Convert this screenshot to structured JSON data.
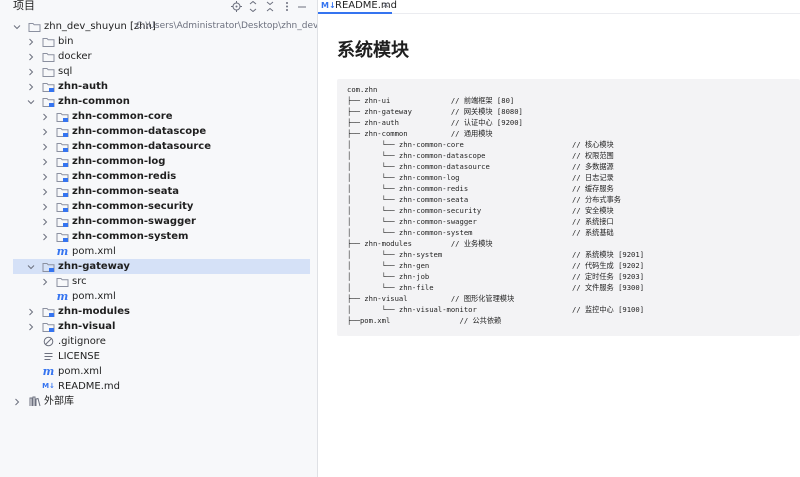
{
  "project_panel": {
    "title": "项目",
    "tree": [
      {
        "label": "zhn_dev_shuyun [zhn]",
        "path": "C:\\Users\\Administrator\\Desktop\\zhn_dev_shuyu",
        "type": "root-folder",
        "bold": false,
        "depth": 0,
        "expanded": true
      },
      {
        "label": "bin",
        "type": "folder",
        "depth": 1,
        "expanded": false,
        "bold": false
      },
      {
        "label": "docker",
        "type": "folder",
        "depth": 1,
        "expanded": false,
        "bold": false
      },
      {
        "label": "sql",
        "type": "folder",
        "depth": 1,
        "expanded": false,
        "bold": false
      },
      {
        "label": "zhn-auth",
        "type": "module",
        "depth": 1,
        "expanded": false,
        "bold": true
      },
      {
        "label": "zhn-common",
        "type": "module",
        "depth": 1,
        "expanded": true,
        "bold": true
      },
      {
        "label": "zhn-common-core",
        "type": "module",
        "depth": 2,
        "expanded": false,
        "bold": true
      },
      {
        "label": "zhn-common-datascope",
        "type": "module",
        "depth": 2,
        "expanded": false,
        "bold": true
      },
      {
        "label": "zhn-common-datasource",
        "type": "module",
        "depth": 2,
        "expanded": false,
        "bold": true
      },
      {
        "label": "zhn-common-log",
        "type": "module",
        "depth": 2,
        "expanded": false,
        "bold": true
      },
      {
        "label": "zhn-common-redis",
        "type": "module",
        "depth": 2,
        "expanded": false,
        "bold": true
      },
      {
        "label": "zhn-common-seata",
        "type": "module",
        "depth": 2,
        "expanded": false,
        "bold": true
      },
      {
        "label": "zhn-common-security",
        "type": "module",
        "depth": 2,
        "expanded": false,
        "bold": true
      },
      {
        "label": "zhn-common-swagger",
        "type": "module",
        "depth": 2,
        "expanded": false,
        "bold": true
      },
      {
        "label": "zhn-common-system",
        "type": "module",
        "depth": 2,
        "expanded": false,
        "bold": true
      },
      {
        "label": "pom.xml",
        "type": "maven",
        "depth": 2,
        "bold": false
      },
      {
        "label": "zhn-gateway",
        "type": "module",
        "depth": 1,
        "expanded": true,
        "bold": true,
        "selected": true
      },
      {
        "label": "src",
        "type": "folder",
        "depth": 2,
        "expanded": false,
        "bold": false
      },
      {
        "label": "pom.xml",
        "type": "maven",
        "depth": 2,
        "bold": false
      },
      {
        "label": "zhn-modules",
        "type": "module",
        "depth": 1,
        "expanded": false,
        "bold": true
      },
      {
        "label": "zhn-visual",
        "type": "module",
        "depth": 1,
        "expanded": false,
        "bold": true
      },
      {
        "label": ".gitignore",
        "type": "ignore",
        "depth": 1,
        "bold": false
      },
      {
        "label": "LICENSE",
        "type": "text",
        "depth": 1,
        "bold": false
      },
      {
        "label": "pom.xml",
        "type": "maven",
        "depth": 1,
        "bold": false
      },
      {
        "label": "README.md",
        "type": "markdown",
        "depth": 1,
        "bold": false
      },
      {
        "label": "外部库",
        "type": "library",
        "depth": 0,
        "expanded": false,
        "bold": false
      }
    ]
  },
  "editor": {
    "tab": {
      "icon_text": "M↓",
      "label": "README.md"
    },
    "doc_title": "系统模块",
    "code_lines": [
      "com.zhn",
      "├── zhn-ui              // 前端框架 [80]",
      "├── zhn-gateway         // 网关模块 [8080]",
      "├── zhn-auth            // 认证中心 [9200]",
      "├── zhn-common          // 通用模块",
      "│       └── zhn-common-core                         // 核心模块",
      "│       └── zhn-common-datascope                    // 权限范围",
      "│       └── zhn-common-datasource                   // 多数据源",
      "│       └── zhn-common-log                          // 日志记录",
      "│       └── zhn-common-redis                        // 缓存服务",
      "│       └── zhn-common-seata                        // 分布式事务",
      "│       └── zhn-common-security                     // 安全模块",
      "│       └── zhn-common-swagger                      // 系统接口",
      "│       └── zhn-common-system                       // 系统基础",
      "├── zhn-modules         // 业务模块",
      "│       └── zhn-system                              // 系统模块 [9201]",
      "│       └── zhn-gen                                 // 代码生成 [9202]",
      "│       └── zhn-job                                 // 定时任务 [9203]",
      "│       └── zhn-file                                // 文件服务 [9300]",
      "├── zhn-visual          // 图形化管理模块",
      "│       └── zhn-visual-monitor                      // 监控中心 [9100]",
      "├──pom.xml                // 公共依赖"
    ]
  },
  "colors": {
    "folder": "#8b90a0",
    "module_folder": "#8b90a0",
    "module_badge": "#3574f0",
    "selection": "#d5e1f7",
    "accent": "#3574f0"
  }
}
